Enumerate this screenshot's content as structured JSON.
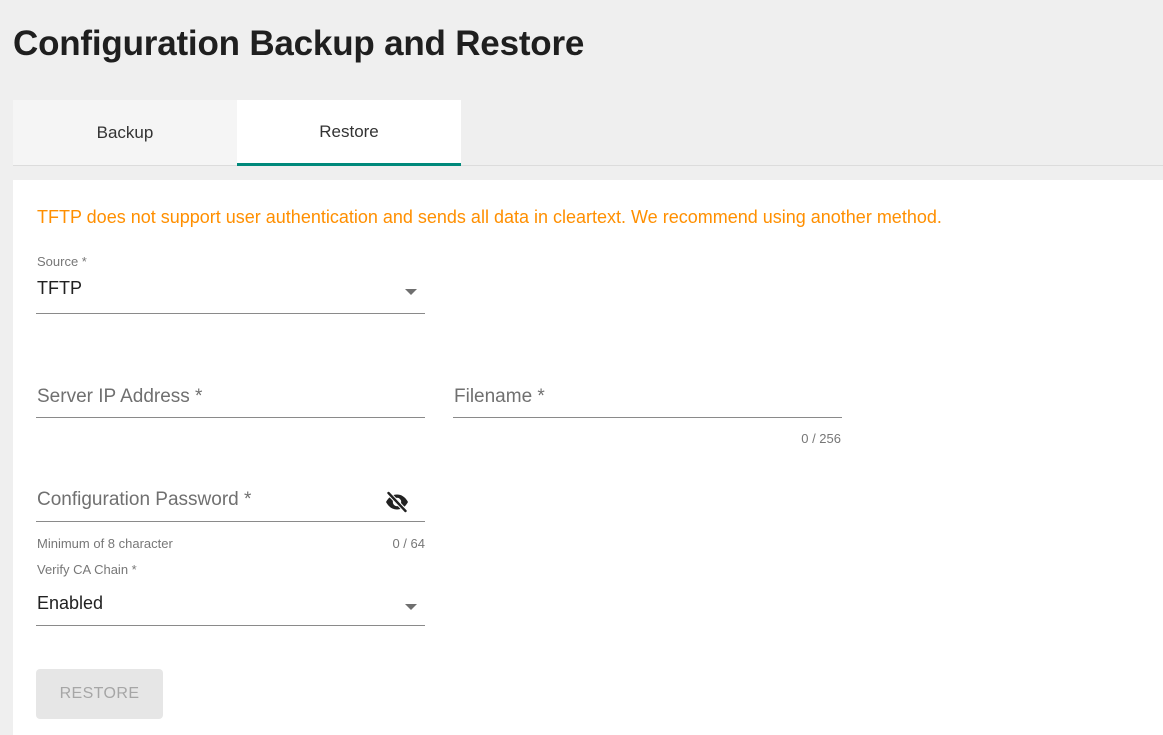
{
  "page": {
    "title": "Configuration Backup and Restore"
  },
  "tabs": [
    {
      "label": "Backup",
      "active": false
    },
    {
      "label": "Restore",
      "active": true
    }
  ],
  "colors": {
    "accent": "#00897b",
    "warning": "#ff8f00",
    "disabled_button_bg": "#e6e6e6",
    "disabled_button_text": "#a6a6a6"
  },
  "restore": {
    "warning": "TFTP does not support user authentication and sends all data in cleartext. We recommend using another method.",
    "source": {
      "label": "Source *",
      "value": "TFTP"
    },
    "server_ip": {
      "placeholder": "Server IP Address *",
      "value": ""
    },
    "filename": {
      "placeholder": "Filename *",
      "value": "",
      "counter": "0 / 256"
    },
    "config_password": {
      "placeholder": "Configuration Password *",
      "value": "",
      "hint": "Minimum of 8 character",
      "counter": "0 / 64",
      "visibility_icon": "eye-off-icon"
    },
    "verify_ca_chain": {
      "label": "Verify CA Chain *",
      "value": "Enabled"
    },
    "restore_button": {
      "label": "RESTORE",
      "disabled": true
    }
  }
}
